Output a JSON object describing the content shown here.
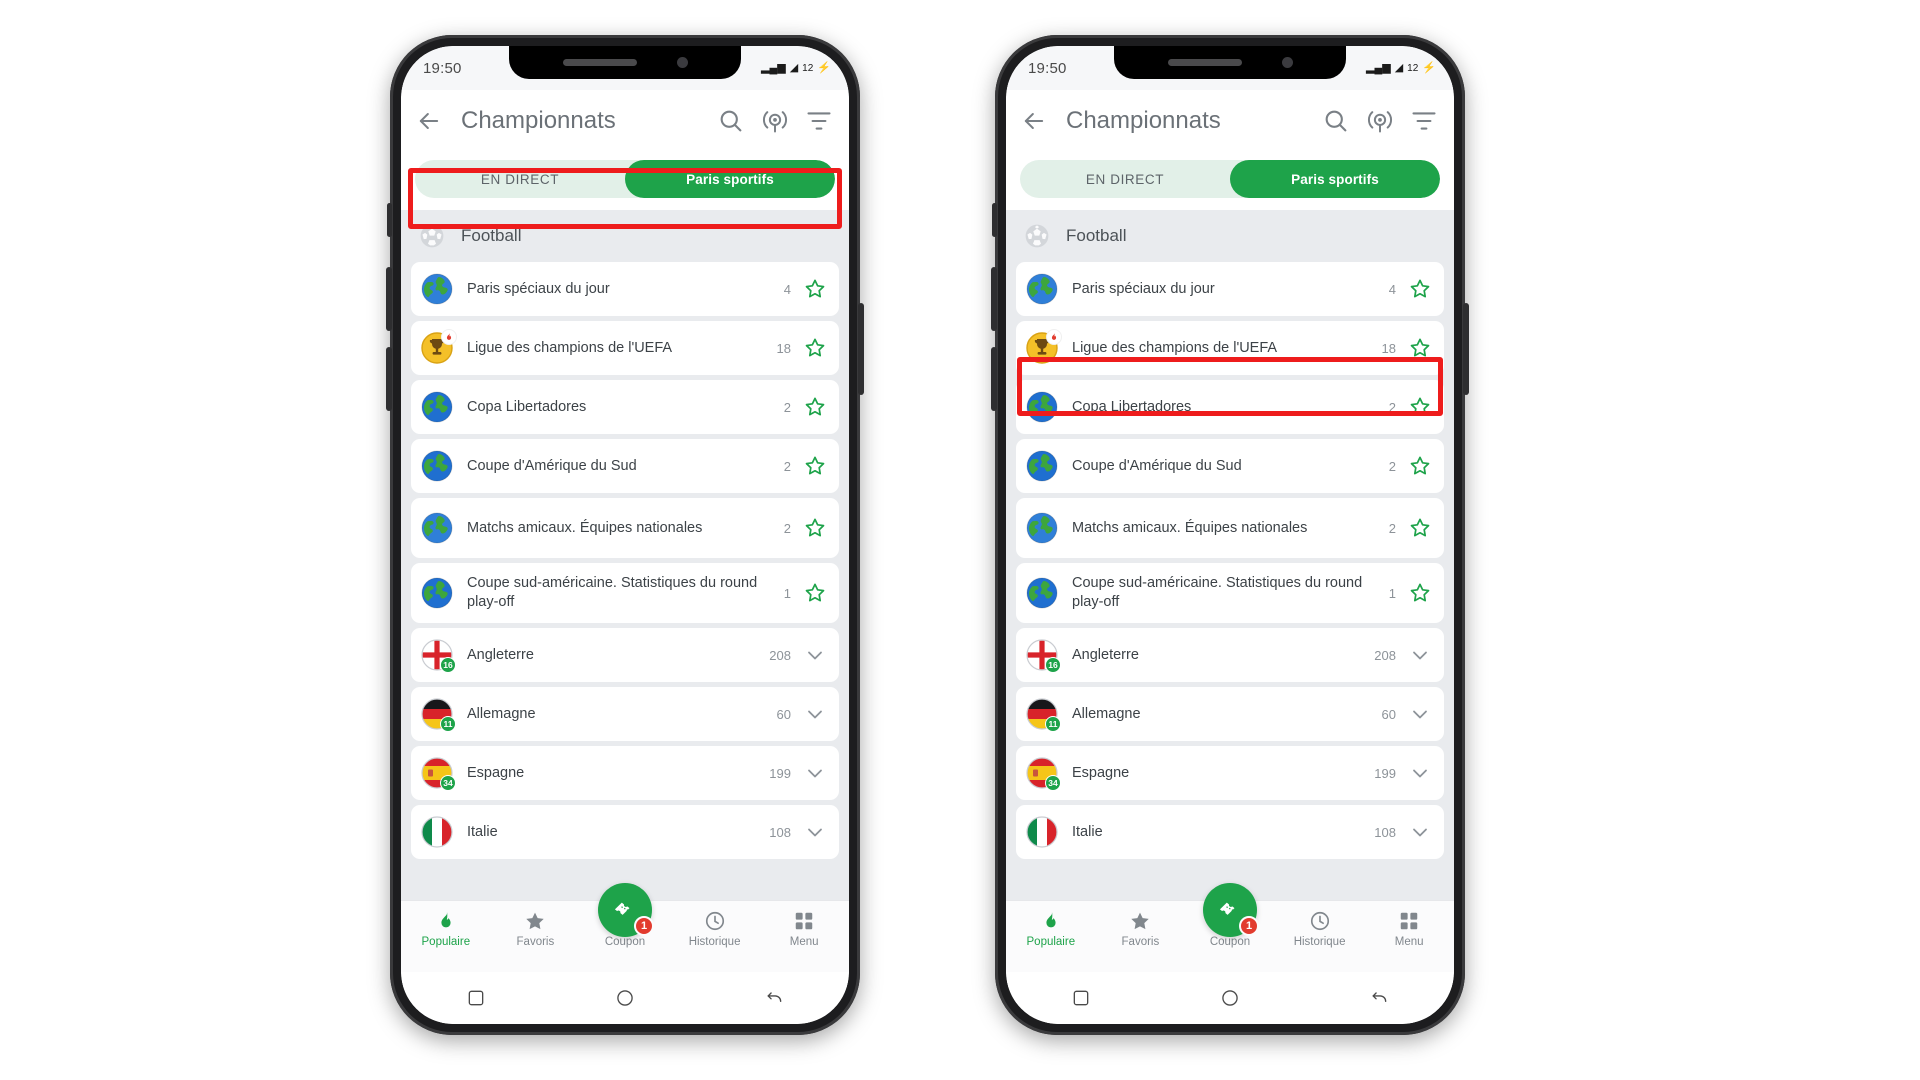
{
  "status_bar": {
    "time": "19:50",
    "signal_label": "▂▄▆",
    "wifi_label": "◢",
    "battery_pct": "12",
    "charging_icon": "⚡"
  },
  "app_bar": {
    "back_icon": "arrow-left-icon",
    "title": "Championnats",
    "actions": [
      {
        "name": "search-icon"
      },
      {
        "name": "broadcast-icon"
      },
      {
        "name": "filter-icon"
      }
    ]
  },
  "segmented_control": {
    "options": [
      {
        "label": "EN DIRECT",
        "active": false
      },
      {
        "label": "Paris sportifs",
        "active": true
      }
    ]
  },
  "sport_header": {
    "icon": "football-icon",
    "label": "Football"
  },
  "league_rows": [
    {
      "label": "Paris spéciaux du jour",
      "count": "4",
      "icon": "globe-icon",
      "icon_variant": "globe-blue",
      "badge": "",
      "action": "star-icon",
      "tall": false
    },
    {
      "label": "Ligue des champions de l'UEFA",
      "count": "18",
      "icon": "trophy-icon",
      "icon_variant": "trophy-gold",
      "badge": "flame",
      "action": "star-icon",
      "tall": false
    },
    {
      "label": "Copa Libertadores",
      "count": "2",
      "icon": "globe-icon",
      "icon_variant": "globe-blue-2",
      "badge": "",
      "action": "star-icon",
      "tall": false
    },
    {
      "label": "Coupe d'Amérique du Sud",
      "count": "2",
      "icon": "globe-icon",
      "icon_variant": "globe-blue-2",
      "badge": "",
      "action": "star-icon",
      "tall": false
    },
    {
      "label": "Matchs amicaux. Équipes nationales",
      "count": "2",
      "icon": "globe-icon",
      "icon_variant": "globe-blue",
      "badge": "",
      "action": "star-icon",
      "tall": true
    },
    {
      "label": "Coupe sud-américaine. Statistiques du round play-off",
      "count": "1",
      "icon": "globe-icon",
      "icon_variant": "globe-blue-2",
      "badge": "",
      "action": "star-icon",
      "tall": true
    },
    {
      "label": "Angleterre",
      "count": "208",
      "icon": "flag-england-icon",
      "icon_variant": "flag-england",
      "badge": "16",
      "action": "chevron-down-icon",
      "tall": false
    },
    {
      "label": "Allemagne",
      "count": "60",
      "icon": "flag-germany-icon",
      "icon_variant": "flag-germany",
      "badge": "11",
      "action": "chevron-down-icon",
      "tall": false
    },
    {
      "label": "Espagne",
      "count": "199",
      "icon": "flag-spain-icon",
      "icon_variant": "flag-spain",
      "badge": "34",
      "action": "chevron-down-icon",
      "tall": false
    },
    {
      "label": "Italie",
      "count": "108",
      "icon": "flag-italy-icon",
      "icon_variant": "flag-italy",
      "badge": "",
      "action": "chevron-down-icon",
      "tall": false
    }
  ],
  "bottom_nav": {
    "items": [
      {
        "label": "Populaire",
        "icon": "flame-icon",
        "active": true
      },
      {
        "label": "Favoris",
        "icon": "star-icon",
        "active": false
      },
      {
        "label": "Coupon",
        "icon": "ticket-icon",
        "active": false,
        "badge": "1"
      },
      {
        "label": "Historique",
        "icon": "clock-icon",
        "active": false
      },
      {
        "label": "Menu",
        "icon": "grid-icon",
        "active": false
      }
    ]
  },
  "system_bar": {
    "buttons": [
      {
        "name": "android-recents-button",
        "icon": "square-icon"
      },
      {
        "name": "android-home-button",
        "icon": "circle-icon"
      },
      {
        "name": "android-back-button",
        "icon": "back-arrow-icon"
      }
    ]
  },
  "annotations": [
    {
      "name": "highlight-segmented-control",
      "color": "#ee1c1c",
      "phone": "left"
    },
    {
      "name": "highlight-uefa-row",
      "color": "#ee1c1c",
      "phone": "right"
    }
  ]
}
